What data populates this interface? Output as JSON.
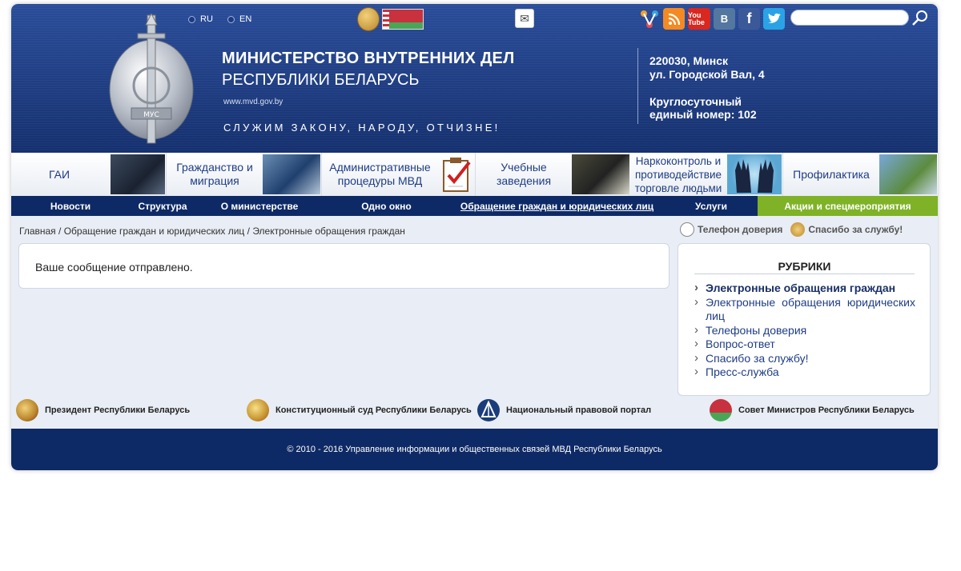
{
  "header": {
    "languages": [
      "RU",
      "EN"
    ],
    "title_line1": "МИНИСТЕРСТВО ВНУТРЕННИХ ДЕЛ",
    "title_line2": "РЕСПУБЛИКИ БЕЛАРУСЬ",
    "site": "www.mvd.gov.by",
    "motto": "СЛУЖИМ ЗАКОНУ, НАРОДУ, ОТЧИЗНЕ!",
    "badge_text": "МУС",
    "address_line1": "220030, Минск",
    "address_line2": "ул. Городской Вал, 4",
    "hotline_line1": "Круглосуточный",
    "hotline_line2": "единый номер: 102",
    "social": [
      "share-icon",
      "rss-icon",
      "youtube-icon",
      "vk-icon",
      "facebook-icon",
      "twitter-icon"
    ],
    "social_text": {
      "youtube": "You Tube",
      "vk": "B",
      "facebook": "f"
    },
    "search_placeholder": ""
  },
  "categories": [
    {
      "label": "ГАИ"
    },
    {
      "label": "Гражданство и миграция"
    },
    {
      "label": "Административные процедуры МВД"
    },
    {
      "label": "Учебные заведения"
    },
    {
      "label": "Наркоконтроль и противодействие торговле людьми"
    },
    {
      "label": "Профилактика"
    }
  ],
  "nav": [
    {
      "label": "Новости"
    },
    {
      "label": "Структура"
    },
    {
      "label": "О министерстве"
    },
    {
      "label": "Одно окно"
    },
    {
      "label": "Обращение граждан и юридических лиц"
    },
    {
      "label": "Услуги"
    },
    {
      "label": "Акции и спецмероприятия"
    }
  ],
  "breadcrumb": {
    "items": [
      "Главная",
      "Обращение граждан и юридических лиц",
      "Электронные обращения граждан"
    ],
    "separator": " / "
  },
  "trust": {
    "phone": "Телефон доверия",
    "thanks": "Спасибо за службу!"
  },
  "message": "Ваше сообщение отправлено.",
  "rubrics": {
    "title": "РУБРИКИ",
    "items": [
      "Электронные обращения граждан",
      "Электронные обращения юридических лиц",
      "Телефоны доверия",
      "Вопрос-ответ",
      "Спасибо за службу!",
      "Пресс-служба"
    ]
  },
  "links": [
    "Президент Республики Беларусь",
    "Конституционный суд Республики Беларусь",
    "Национальный правовой портал",
    "Совет Министров Республики Беларусь"
  ],
  "footer": "© 2010 - 2016  Управление информации и общественных связей МВД Республики Беларусь",
  "colors": {
    "header": "#1c3a82",
    "nav": "#0e2a66",
    "accent_green": "#7fb227",
    "link": "#1f3d84"
  }
}
